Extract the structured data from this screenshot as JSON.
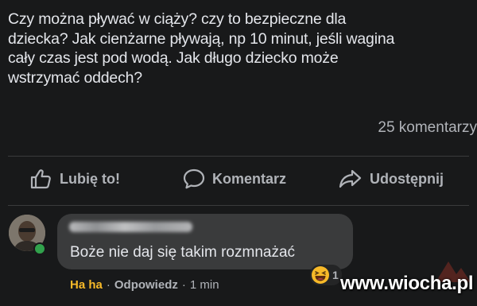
{
  "post": {
    "text_lines": [
      "Czy można pływać w ciąży? czy to bezpieczne dla",
      "dziecka? Jak cienżarne pływają, np 10 minut, jeśli wagina",
      "cały czas jest pod wodą. Jak długo dziecko może",
      "wstrzymać oddech?"
    ],
    "comment_count": "25 komentarzy"
  },
  "actions": {
    "like_label": "Lubię to!",
    "comment_label": "Komentarz",
    "share_label": "Udostępnij",
    "like_icon": "thumbs-up-icon",
    "comment_icon": "speech-bubble-icon",
    "share_icon": "share-arrow-icon"
  },
  "comment": {
    "author_name": "",
    "text": "Boże nie daj się takim rozmnażać",
    "reaction_icon": "haha-emoji-icon",
    "reaction_count": "1",
    "haha_label": "Ha ha",
    "reply_label": "Odpowiedz",
    "separator": "·",
    "time": "1 min"
  },
  "watermark": {
    "text": "www.wiocha.pl"
  },
  "colors": {
    "background": "#18191a",
    "text": "#e4e6eb",
    "muted": "#b0b3b8",
    "bubble": "#3a3b3c",
    "haha": "#f7b928",
    "online": "#31a24c"
  }
}
